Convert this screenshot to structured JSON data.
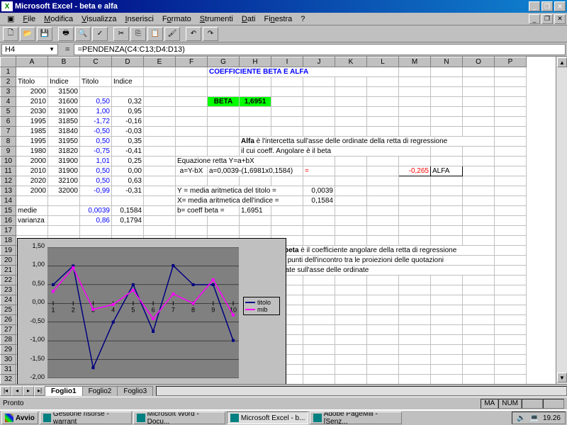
{
  "app": {
    "title": "Microsoft Excel - beta e alfa"
  },
  "menu": [
    "File",
    "Modifica",
    "Visualizza",
    "Inserisci",
    "Formato",
    "Strumenti",
    "Dati",
    "Finestra",
    "?"
  ],
  "menu_underline": [
    "F",
    "M",
    "V",
    "I",
    "o",
    "S",
    "D",
    "n",
    "?"
  ],
  "cellref": "H4",
  "formula": "=PENDENZA(C4:C13;D4:D13)",
  "cols": [
    "A",
    "B",
    "C",
    "D",
    "E",
    "F",
    "G",
    "H",
    "I",
    "J",
    "K",
    "L",
    "M",
    "N",
    "O",
    "P"
  ],
  "rows17": 17,
  "header_row": {
    "G": "COEFFICIENTE  BETA E ALFA"
  },
  "title2": {
    "A": "Titolo",
    "B": "Indice",
    "C": "Titolo",
    "D": "Indice"
  },
  "beta_label": "BETA",
  "beta_val": "1,6951",
  "alfa_text1": "Alfa è l'intercetta sull'asse delle ordinate della retta di regressione",
  "alfa_text2": "il cui coeff. Angolare è il beta",
  "alfa_bold": "Alfa",
  "eq_label": "Equazione retta Y=a+bX",
  "eq_sub": "a=Y-bX",
  "eq_calc": "a=0,0039-(1,6981x0,1584)",
  "eq_eq": "=",
  "alfa_val": "-0,265",
  "alfa_lbl": "ALFA",
  "y_line": "Y = media aritmetica del titolo =",
  "y_val": "0,0039",
  "x_line": "X= media aritmetica dell'indice =",
  "x_val": "0,1584",
  "b_line": "b= coeff beta =",
  "b_val": "1,6951",
  "medie": "medie",
  "varianza": "varianza",
  "medie_c": "0,0039",
  "medie_d": "0,1584",
  "var_c": "0,86",
  "var_d": "0,1794",
  "beta_text1": "Il coefficiente beta è il coefficiente angolare della retta di regressione",
  "beta_text2": "passante  per i punti dell'incontro tra le proiezioni delle quotazioni",
  "beta_text3": "del titolo riportate sull'asse delle ordinate",
  "beta_bold": "beta",
  "data_table": [
    [
      "2000",
      "31500",
      "",
      ""
    ],
    [
      "2010",
      "31600",
      "0,50",
      "0,32"
    ],
    [
      "2030",
      "31900",
      "1,00",
      "0,95"
    ],
    [
      "1995",
      "31850",
      "-1,72",
      "-0,16"
    ],
    [
      "1985",
      "31840",
      "-0,50",
      "-0,03"
    ],
    [
      "1995",
      "31950",
      "0,50",
      "0,35"
    ],
    [
      "1980",
      "31820",
      "-0,75",
      "-0,41"
    ],
    [
      "2000",
      "31900",
      "1,01",
      "0,25"
    ],
    [
      "2010",
      "31900",
      "0,50",
      "0,00"
    ],
    [
      "2020",
      "32100",
      "0,50",
      "0,63"
    ],
    [
      "2000",
      "32000",
      "-0,99",
      "-0,31"
    ]
  ],
  "chart_data": {
    "type": "line",
    "x": [
      1,
      2,
      3,
      4,
      5,
      6,
      7,
      8,
      9,
      10
    ],
    "ylim": [
      -2.0,
      1.5
    ],
    "yticks": [
      "1,50",
      "1,00",
      "0,50",
      "0,00",
      "-0,50",
      "-1,00",
      "-1,50",
      "-2,00"
    ],
    "series": [
      {
        "name": "titolo",
        "color": "#000080",
        "values": [
          0.5,
          1.0,
          -1.72,
          -0.5,
          0.5,
          -0.75,
          1.01,
          0.5,
          0.5,
          -0.99
        ]
      },
      {
        "name": "mib",
        "color": "#ff00ff",
        "values": [
          0.32,
          0.95,
          -0.16,
          -0.03,
          0.35,
          -0.41,
          0.25,
          0.0,
          0.63,
          -0.31
        ]
      }
    ]
  },
  "sheets": [
    "Foglio1",
    "Foglio2",
    "Foglio3"
  ],
  "status": "Pronto",
  "status_ma": "MA",
  "status_num": "NUM",
  "start": "Avvio",
  "tasks": [
    {
      "label": "Gestione risorse - warrant",
      "active": false
    },
    {
      "label": "Microsoft Word - Docu...",
      "active": false
    },
    {
      "label": "Microsoft Excel - b...",
      "active": true
    },
    {
      "label": "Adobe PageMill - [Senz...",
      "active": false
    }
  ],
  "clock": "19.26"
}
